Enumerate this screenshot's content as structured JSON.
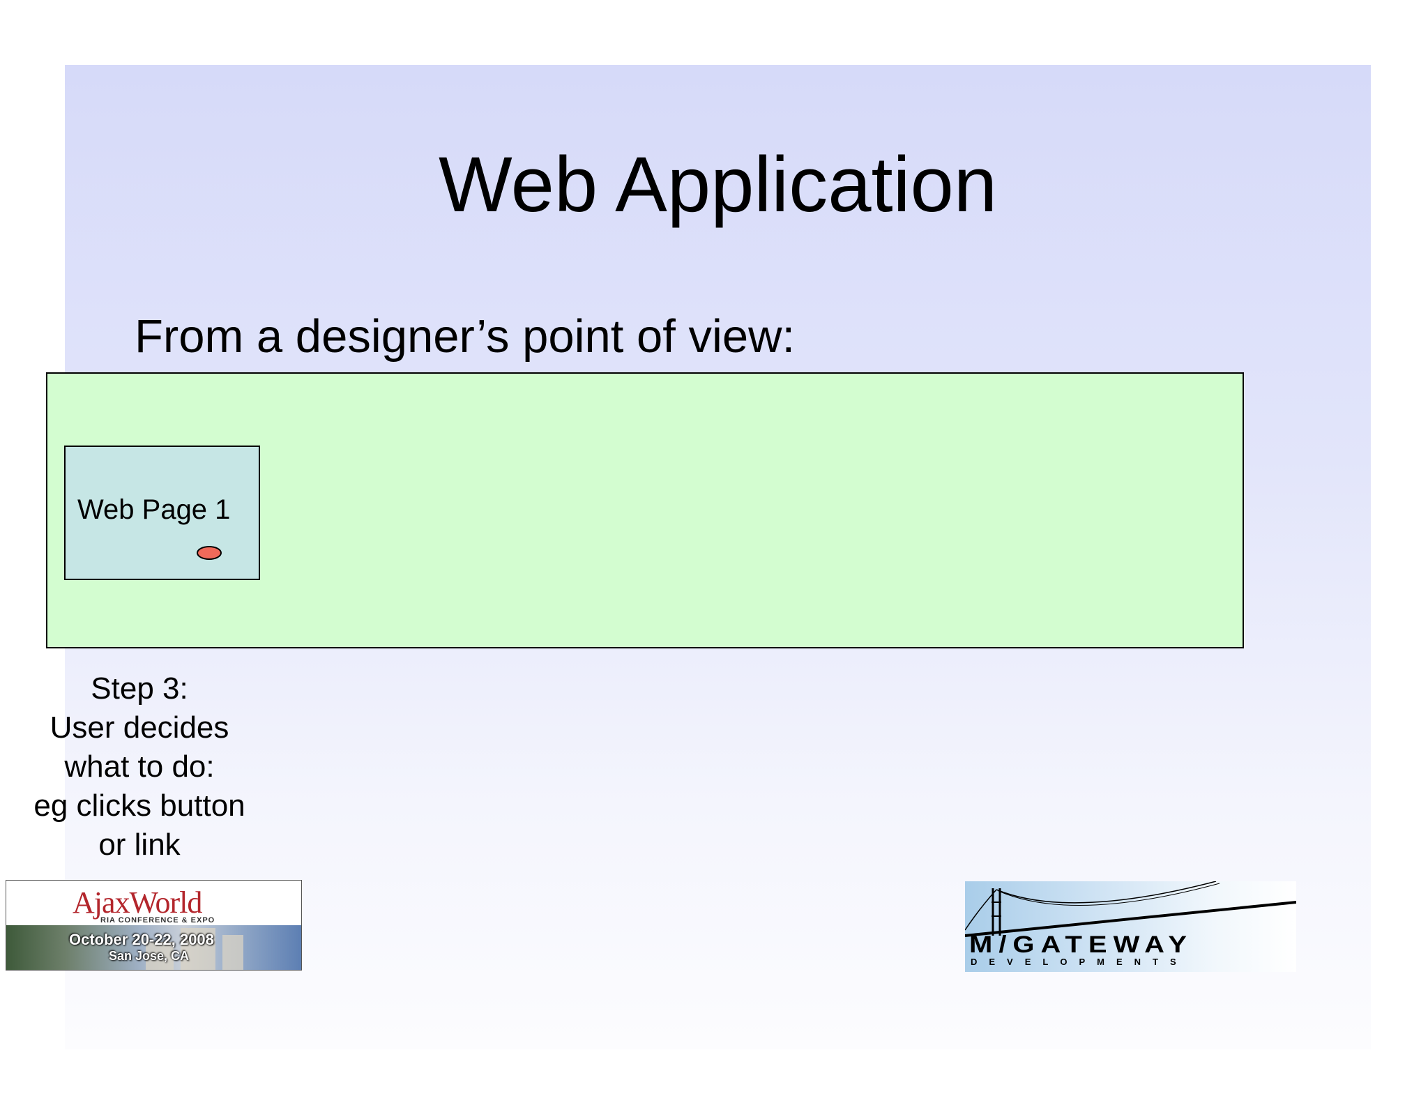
{
  "slide": {
    "title": "Web Application",
    "subtitle": "From a designer’s point of view:"
  },
  "diagram": {
    "page_label": "Web Page 1",
    "step_lines": [
      "Step 3:",
      "User decides",
      "what to do:",
      "eg clicks button",
      "or link"
    ]
  },
  "logos": {
    "ajaxworld": {
      "name": "AjaxWorld",
      "tagline": "RIA CONFERENCE & EXPO",
      "dates": "October 20-22, 2008",
      "place": "San Jose, CA"
    },
    "mgateway": {
      "name": "M/GATEWAY",
      "sub": "DEVELOPMENTS"
    }
  },
  "colors": {
    "app_box": "#d3fdd0",
    "page_box": "#c6e6e5",
    "button_dot": "#f06a5a",
    "ajax_red": "#b3262c"
  }
}
